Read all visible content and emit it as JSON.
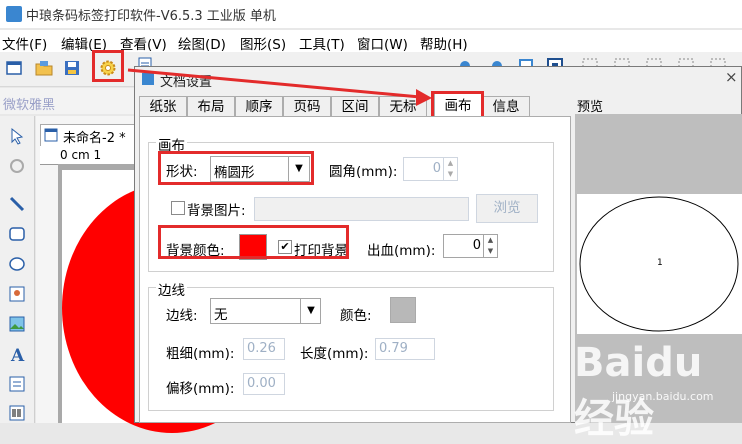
{
  "app": {
    "title": "中琅条码标签打印软件-V6.5.3 工业版 单机"
  },
  "menu": {
    "items": [
      "文件(F)",
      "编辑(E)",
      "查看(V)",
      "绘图(D)",
      "图形(S)",
      "工具(T)",
      "窗口(W)",
      "帮助(H)"
    ]
  },
  "subbar": {
    "label": "微软雅黑"
  },
  "document": {
    "tab_label": "未命名-2 *",
    "ruler_text": "0 cm 1"
  },
  "dialog": {
    "title": "文档设置",
    "close": "×",
    "tabs": [
      "纸张",
      "布局",
      "顺序",
      "页码",
      "区间",
      "无标",
      "画布",
      "信息"
    ],
    "active_tab": "画布",
    "canvas_group": {
      "legend": "画布",
      "shape_label": "形状:",
      "shape_value": "椭圆形",
      "radius_label": "圆角(mm):",
      "radius_value": "0",
      "bg_image_label": "背景图片:",
      "bg_image_checked": false,
      "browse_label": "浏览",
      "bg_color_label": "背景颜色:",
      "bg_color": "#ff0000",
      "print_bg_label": "打印背景",
      "print_bg_checked": true,
      "bleed_label": "出血(mm):",
      "bleed_value": "0"
    },
    "border_group": {
      "legend": "边线",
      "border_label": "边线:",
      "border_value": "无",
      "color_label": "颜色:",
      "color": "#b8b8b8",
      "thickness_label": "粗细(mm):",
      "thickness_value": "0.26",
      "length_label": "长度(mm):",
      "length_value": "0.79",
      "offset_label": "偏移(mm):",
      "offset_value": "0.00"
    },
    "preview": {
      "label": "预览",
      "page_number": "1"
    }
  },
  "watermark": {
    "text": "Baidu经验",
    "url": "jingyan.baidu.com"
  },
  "colors": {
    "highlight": "#e32b2b",
    "accent": "#3a86d0"
  }
}
